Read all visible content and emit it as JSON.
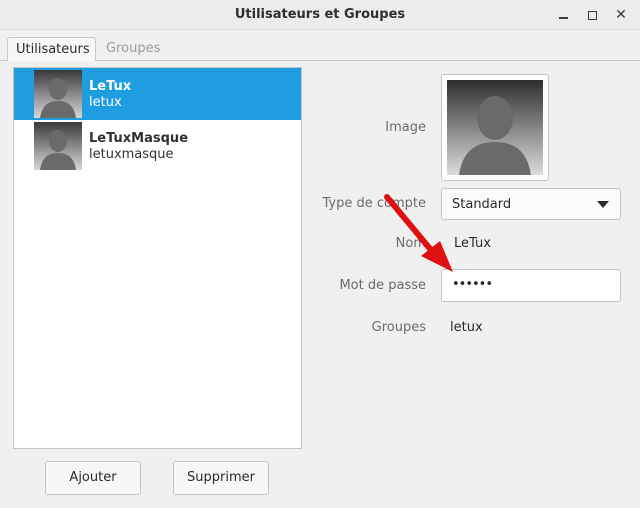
{
  "window": {
    "title": "Utilisateurs et Groupes",
    "close_glyph": "✕"
  },
  "tabs": [
    {
      "label": "Utilisateurs",
      "active": true
    },
    {
      "label": "Groupes",
      "active": false
    }
  ],
  "users": [
    {
      "name": "LeTux",
      "login": "letux",
      "selected": true
    },
    {
      "name": "LeTuxMasque",
      "login": "letuxmasque",
      "selected": false
    }
  ],
  "list_buttons": {
    "add_label": "Ajouter",
    "delete_label": "Supprimer"
  },
  "details": {
    "image_label": "Image",
    "account_type_label": "Type de compte",
    "account_type_value": "Standard",
    "name_label": "Nom",
    "name_value": "LeTux",
    "password_label": "Mot de passe",
    "password_value": "••••••",
    "groups_label": "Groupes",
    "groups_value": "letux"
  },
  "colors": {
    "selection": "#1e9ee0",
    "annotation_arrow": "#e01010"
  },
  "icons": {
    "avatar": "default-user-avatar-icon",
    "dropdown": "chevron-down-icon",
    "annotation": "red-arrow-icon"
  }
}
